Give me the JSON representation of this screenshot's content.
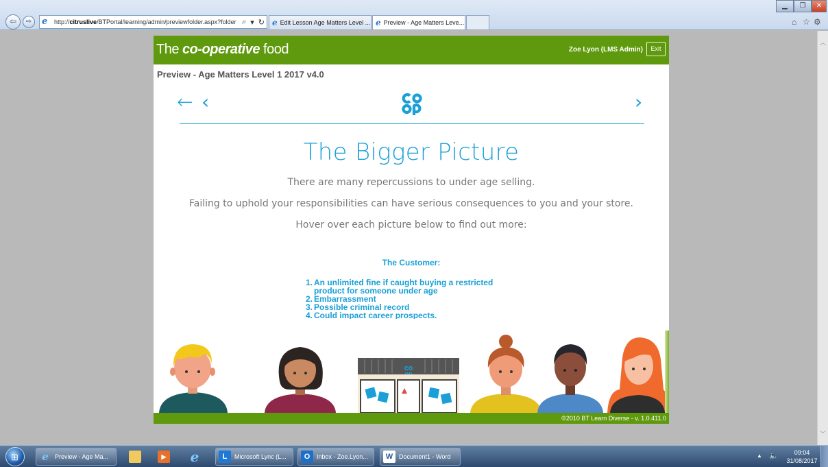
{
  "browser": {
    "url_prefix": "http://",
    "url_host": "citruslive",
    "url_path": "/BTPortal/learning/admin/previewfolder.aspx?folder",
    "tabs": [
      {
        "label": "Edit Lesson Age Matters Level ..."
      },
      {
        "label": "Preview - Age Matters Leve...",
        "close": "×"
      }
    ],
    "icons": [
      "back-arrow-icon",
      "forward-arrow-icon",
      "ie-icon",
      "search-icon",
      "refresh-icon",
      "home-icon",
      "favorites-star-icon",
      "gear-icon"
    ]
  },
  "header": {
    "brand_prefix": "The ",
    "brand_bold": "co-operative",
    "brand_suffix": " food",
    "user": "Zoe Lyon (LMS Admin)",
    "exit_label": "Exit",
    "color": "#5f9a0e"
  },
  "preview_title": "Preview - Age Matters Level 1 2017 v4.0",
  "slide": {
    "nav_back": "←",
    "nav_prev": "‹",
    "nav_next": "›",
    "logo_text": "co op",
    "title": "The Bigger Picture",
    "line1": "There are many repercussions to under age selling.",
    "line2": "Failing to uphold your responsibilities can have serious consequences to you and your store.",
    "line3": "Hover over each picture below to find out more:",
    "customer": {
      "heading": "The Customer:",
      "items": [
        {
          "num": "1.",
          "text": "An unlimited fine if caught buying a restricted product for someone under age"
        },
        {
          "num": "2.",
          "text": "Embarrassment"
        },
        {
          "num": "3.",
          "text": "Possible criminal record"
        },
        {
          "num": "4.",
          "text": "Could impact career prospects."
        }
      ]
    },
    "accent": "#1aa0d7"
  },
  "footer": {
    "text": "©2010 BT Learn Diverse - v. 1.0.411.0"
  },
  "taskbar": {
    "items": [
      {
        "label": "Preview - Age Ma..."
      },
      {
        "label": "Microsoft Lync (L..."
      },
      {
        "label": "Inbox - Zoe.Lyon..."
      },
      {
        "label": "Document1 - Word"
      }
    ],
    "time": "09:04",
    "date": "31/08/2017"
  }
}
